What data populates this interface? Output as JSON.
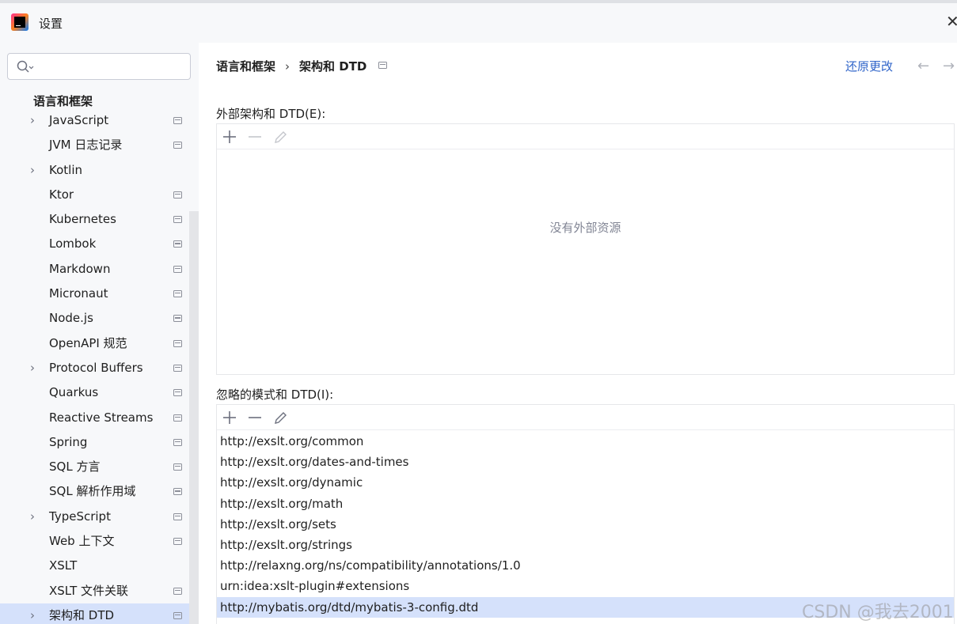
{
  "window": {
    "title": "设置"
  },
  "search": {
    "placeholder": ""
  },
  "sidebar": {
    "section_title": "语言和框架",
    "items": [
      {
        "label": "JavaScript",
        "expandable": true,
        "project_icon": true
      },
      {
        "label": "JVM 日志记录",
        "expandable": false,
        "project_icon": true
      },
      {
        "label": "Kotlin",
        "expandable": true,
        "project_icon": false
      },
      {
        "label": "Ktor",
        "expandable": false,
        "project_icon": true
      },
      {
        "label": "Kubernetes",
        "expandable": false,
        "project_icon": true
      },
      {
        "label": "Lombok",
        "expandable": false,
        "project_icon": true
      },
      {
        "label": "Markdown",
        "expandable": false,
        "project_icon": true
      },
      {
        "label": "Micronaut",
        "expandable": false,
        "project_icon": true
      },
      {
        "label": "Node.js",
        "expandable": false,
        "project_icon": true
      },
      {
        "label": "OpenAPI 规范",
        "expandable": false,
        "project_icon": true
      },
      {
        "label": "Protocol Buffers",
        "expandable": true,
        "project_icon": true
      },
      {
        "label": "Quarkus",
        "expandable": false,
        "project_icon": true
      },
      {
        "label": "Reactive Streams",
        "expandable": false,
        "project_icon": true
      },
      {
        "label": "Spring",
        "expandable": false,
        "project_icon": true
      },
      {
        "label": "SQL 方言",
        "expandable": false,
        "project_icon": true
      },
      {
        "label": "SQL 解析作用域",
        "expandable": false,
        "project_icon": true
      },
      {
        "label": "TypeScript",
        "expandable": true,
        "project_icon": true
      },
      {
        "label": "Web 上下文",
        "expandable": false,
        "project_icon": true
      },
      {
        "label": "XSLT",
        "expandable": false,
        "project_icon": false
      },
      {
        "label": "XSLT 文件关联",
        "expandable": false,
        "project_icon": true
      },
      {
        "label": "架构和 DTD",
        "expandable": true,
        "project_icon": true,
        "selected": true
      }
    ]
  },
  "header": {
    "breadcrumb_parent": "语言和框架",
    "breadcrumb_separator": "›",
    "breadcrumb_current": "架构和 DTD",
    "reset_label": "还原更改",
    "back_arrow": "←",
    "forward_arrow": "→"
  },
  "external": {
    "label": "外部架构和 DTD(E):",
    "empty_text": "没有外部资源"
  },
  "ignored": {
    "label": "忽略的模式和 DTD(I):",
    "items": [
      "http://exslt.org/common",
      "http://exslt.org/dates-and-times",
      "http://exslt.org/dynamic",
      "http://exslt.org/math",
      "http://exslt.org/sets",
      "http://exslt.org/strings",
      "http://relaxng.org/ns/compatibility/annotations/1.0",
      "urn:idea:xslt-plugin#extensions",
      "http://mybatis.org/dtd/mybatis-3-config.dtd"
    ],
    "selected_index": 8
  },
  "watermark": {
    "text": "CSDN @我去2001"
  },
  "colors": {
    "accent": "#2f64c9",
    "selection": "#d5e1fb",
    "sidebar_bg": "#f7f8fa"
  },
  "icons": {
    "add": "plus-icon",
    "remove": "minus-icon",
    "edit": "pencil-icon",
    "search": "search-icon",
    "project": "project-level-icon"
  }
}
